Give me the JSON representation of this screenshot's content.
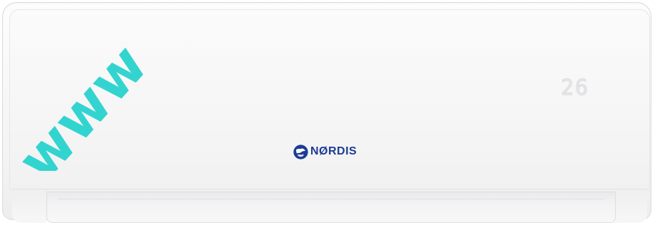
{
  "product": {
    "display_reading": "26",
    "brand_name": "NØRDIS"
  },
  "watermark": {
    "text": "www",
    "color": "#1ed1cc"
  },
  "colors": {
    "brand": "#1c3c93",
    "body": "#f6f6f7"
  }
}
